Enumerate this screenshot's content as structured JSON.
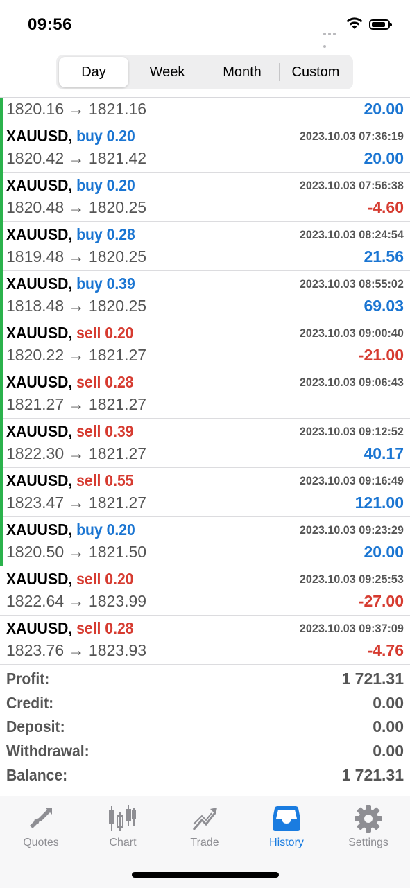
{
  "status_bar": {
    "time": "09:56"
  },
  "period_tabs": [
    {
      "label": "Day",
      "active": true
    },
    {
      "label": "Week",
      "active": false
    },
    {
      "label": "Month",
      "active": false
    },
    {
      "label": "Custom",
      "active": false
    }
  ],
  "partial_row": {
    "prices": "1820.16 → 1821.16",
    "profit": "20.00"
  },
  "deals": [
    {
      "symbol": "XAUUSD,",
      "side": "buy",
      "volume": "0.20",
      "datetime": "2023.10.03 07:36:19",
      "prices": "1820.42 → 1821.42",
      "profit": "20.00",
      "profit_sign": "pos",
      "bar": true
    },
    {
      "symbol": "XAUUSD,",
      "side": "buy",
      "volume": "0.20",
      "datetime": "2023.10.03 07:56:38",
      "prices": "1820.48 → 1820.25",
      "profit": "-4.60",
      "profit_sign": "neg",
      "bar": true
    },
    {
      "symbol": "XAUUSD,",
      "side": "buy",
      "volume": "0.28",
      "datetime": "2023.10.03 08:24:54",
      "prices": "1819.48 → 1820.25",
      "profit": "21.56",
      "profit_sign": "pos",
      "bar": true
    },
    {
      "symbol": "XAUUSD,",
      "side": "buy",
      "volume": "0.39",
      "datetime": "2023.10.03 08:55:02",
      "prices": "1818.48 → 1820.25",
      "profit": "69.03",
      "profit_sign": "pos",
      "bar": true
    },
    {
      "symbol": "XAUUSD,",
      "side": "sell",
      "volume": "0.20",
      "datetime": "2023.10.03 09:00:40",
      "prices": "1820.22 → 1821.27",
      "profit": "-21.00",
      "profit_sign": "neg",
      "bar": true
    },
    {
      "symbol": "XAUUSD,",
      "side": "sell",
      "volume": "0.28",
      "datetime": "2023.10.03 09:06:43",
      "prices": "1821.27 → 1821.27",
      "profit": "",
      "profit_sign": "pos",
      "bar": true
    },
    {
      "symbol": "XAUUSD,",
      "side": "sell",
      "volume": "0.39",
      "datetime": "2023.10.03 09:12:52",
      "prices": "1822.30 → 1821.27",
      "profit": "40.17",
      "profit_sign": "pos",
      "bar": true
    },
    {
      "symbol": "XAUUSD,",
      "side": "sell",
      "volume": "0.55",
      "datetime": "2023.10.03 09:16:49",
      "prices": "1823.47 → 1821.27",
      "profit": "121.00",
      "profit_sign": "pos",
      "bar": true
    },
    {
      "symbol": "XAUUSD,",
      "side": "buy",
      "volume": "0.20",
      "datetime": "2023.10.03 09:23:29",
      "prices": "1820.50 → 1821.50",
      "profit": "20.00",
      "profit_sign": "pos",
      "bar": true
    },
    {
      "symbol": "XAUUSD,",
      "side": "sell",
      "volume": "0.20",
      "datetime": "2023.10.03 09:25:53",
      "prices": "1822.64 → 1823.99",
      "profit": "-27.00",
      "profit_sign": "neg",
      "bar": false
    },
    {
      "symbol": "XAUUSD,",
      "side": "sell",
      "volume": "0.28",
      "datetime": "2023.10.03 09:37:09",
      "prices": "1823.76 → 1823.93",
      "profit": "-4.76",
      "profit_sign": "neg",
      "bar": false
    }
  ],
  "summary": [
    {
      "label": "Profit:",
      "value": "1 721.31"
    },
    {
      "label": "Credit:",
      "value": "0.00"
    },
    {
      "label": "Deposit:",
      "value": "0.00"
    },
    {
      "label": "Withdrawal:",
      "value": "0.00"
    },
    {
      "label": "Balance:",
      "value": "1 721.31"
    }
  ],
  "tabs": [
    {
      "label": "Quotes",
      "icon": "quotes-icon",
      "active": false
    },
    {
      "label": "Chart",
      "icon": "chart-icon",
      "active": false
    },
    {
      "label": "Trade",
      "icon": "trade-icon",
      "active": false
    },
    {
      "label": "History",
      "icon": "history-icon",
      "active": true
    },
    {
      "label": "Settings",
      "icon": "settings-icon",
      "active": false
    }
  ],
  "colors": {
    "buy": "#1a75d2",
    "sell": "#d63b30",
    "bar": "#2bb24c",
    "active_tab": "#1a7ce0",
    "inactive_tab": "#8e8e93"
  }
}
